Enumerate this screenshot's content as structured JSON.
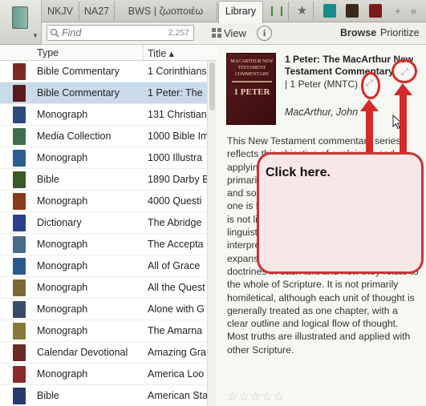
{
  "tabs": [
    {
      "label": "NKJV"
    },
    {
      "label": "NA27"
    },
    {
      "label": "BWS | ζωοποιέω"
    },
    {
      "label": "Library"
    }
  ],
  "tab_extra_icons": [
    "grid-tab-icon",
    "star-icon",
    "book-teal-icon",
    "book-dark-icon",
    "book-red-icon"
  ],
  "tabbar_controls": {
    "add": "+",
    "overflow": "«"
  },
  "search": {
    "placeholder": "Find",
    "count": "2,257"
  },
  "toolbar": {
    "view_label": "View",
    "info_label": "i",
    "browse_label": "Browse",
    "prioritize_label": "Prioritize"
  },
  "columns": {
    "type": "Type",
    "title": "Title ▴"
  },
  "rows": [
    {
      "type": "Bible Commentary",
      "title": "1 Corinthians",
      "color": "#7b2a22"
    },
    {
      "type": "Bible Commentary",
      "title": "1 Peter: The",
      "color": "#5a1a1c",
      "selected": true
    },
    {
      "type": "Monograph",
      "title": "131 Christian",
      "color": "#2c4b7a"
    },
    {
      "type": "Media Collection",
      "title": "1000 Bible Im",
      "color": "#3f6f4a"
    },
    {
      "type": "Monograph",
      "title": "1000 Illustra",
      "color": "#2b5f8f"
    },
    {
      "type": "Bible",
      "title": "1890 Darby B",
      "color": "#3a5a2a"
    },
    {
      "type": "Monograph",
      "title": "4000 Questi",
      "color": "#8a3a1a"
    },
    {
      "type": "Dictionary",
      "title": "The Abridge",
      "color": "#2a3f8a"
    },
    {
      "type": "Monograph",
      "title": "The Accepta",
      "color": "#4a6a8a"
    },
    {
      "type": "Monograph",
      "title": "All of Grace",
      "color": "#2a5a8a"
    },
    {
      "type": "Monograph",
      "title": "All the Quest",
      "color": "#7a6a3a"
    },
    {
      "type": "Monograph",
      "title": "Alone with G",
      "color": "#3a4a6a"
    },
    {
      "type": "Monograph",
      "title": "The Amarna",
      "color": "#8a7a3a"
    },
    {
      "type": "Calendar Devotional",
      "title": "Amazing Gra",
      "color": "#6a2a2a"
    },
    {
      "type": "Monograph",
      "title": "America Loo",
      "color": "#8a2a2a"
    },
    {
      "type": "Bible",
      "title": "American Sta",
      "color": "#2a3a6a"
    }
  ],
  "detail": {
    "book_title": "1 Peter: The MacArthur New Testament Commentary",
    "book_meta": "| 1 Peter (MNTC)",
    "author": "MacArthur, John",
    "description": "This New Testament commentary series reflects this objective of explaining and applying Scripture. Some commentaries are primarily linguistic, others are theological, and some are preaching homiletical. This one is basically explanatory, or expository. It is not linguistically technical but deals with linguistics when this seems helpful to proper interpretation. It is not theologically expansive, but focuses on the major doctrines in each text and how they relate to the whole of Scripture. It is not primarily homiletical, although each unit of thought is generally treated as one chapter, with a clear outline and logical flow of thought. Most truths are illustrated and applied with other Scripture.",
    "rating_stars": "☆☆☆☆☆",
    "cover": {
      "line1": "MACARTHUR NEW",
      "line2": "TESTAMENT",
      "line3": "COMMENTARY",
      "big": "1 PETER"
    }
  },
  "annotation": {
    "text": "Click here."
  }
}
